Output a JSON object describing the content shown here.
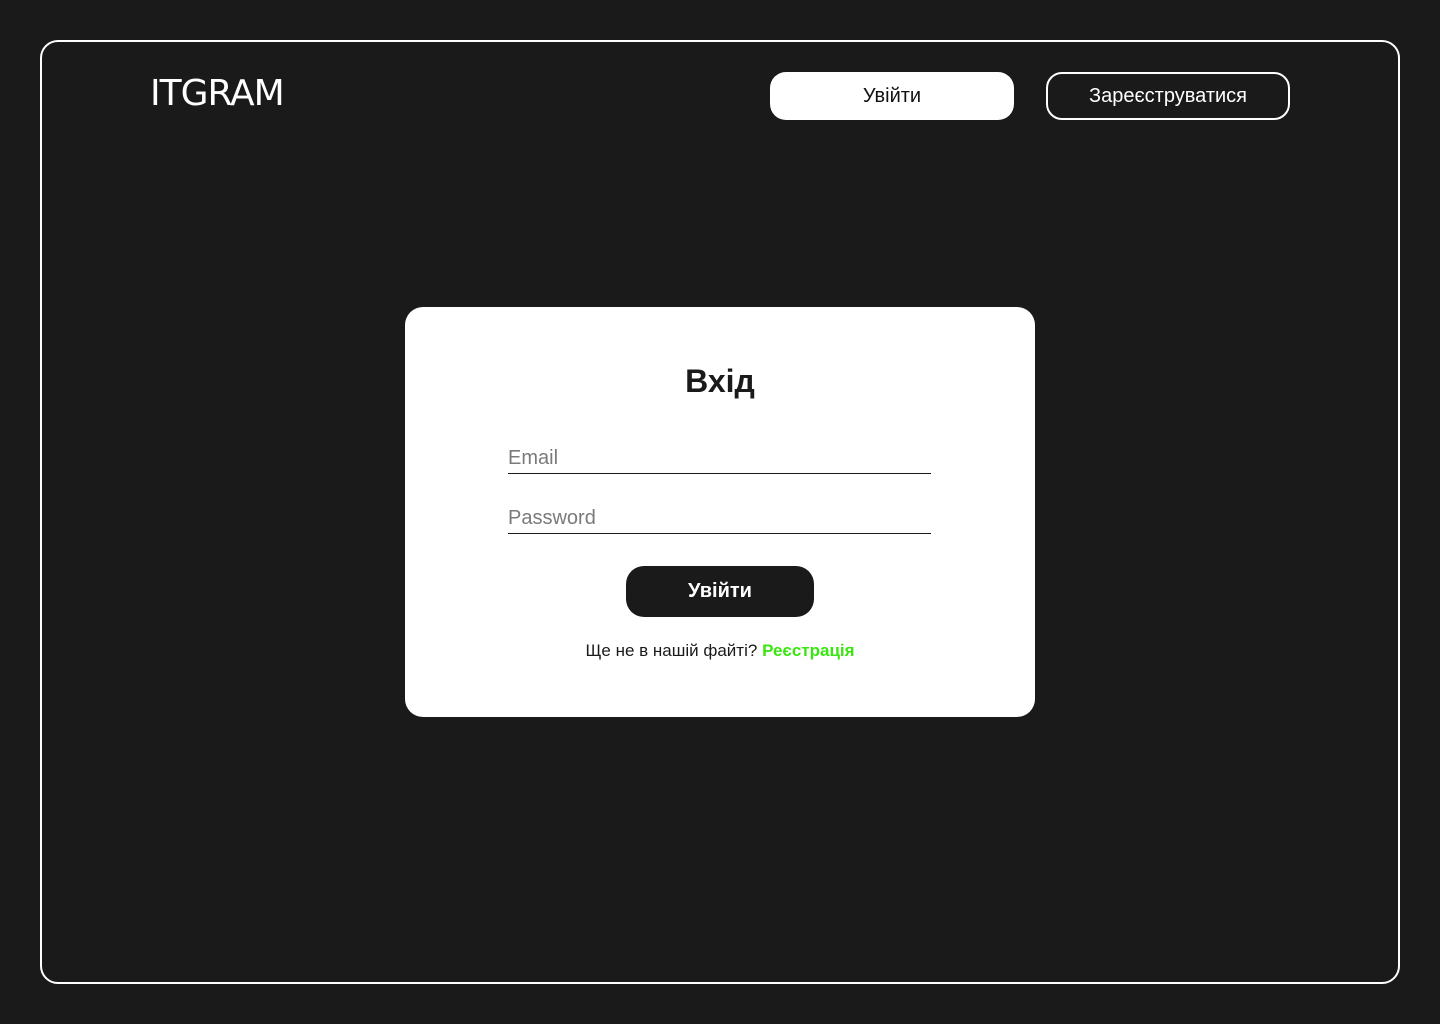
{
  "header": {
    "logo": "ITGRAM",
    "login_label": "Увійти",
    "register_label": "Зареєструватися"
  },
  "login_card": {
    "title": "Вхід",
    "email_placeholder": "Email",
    "password_placeholder": "Password",
    "submit_label": "Увійти",
    "signup_prompt": "Ще не в нашій файті?",
    "signup_link": "Реєстрація"
  },
  "colors": {
    "background": "#1a1a1a",
    "card": "#ffffff",
    "accent_link": "#39e611"
  }
}
